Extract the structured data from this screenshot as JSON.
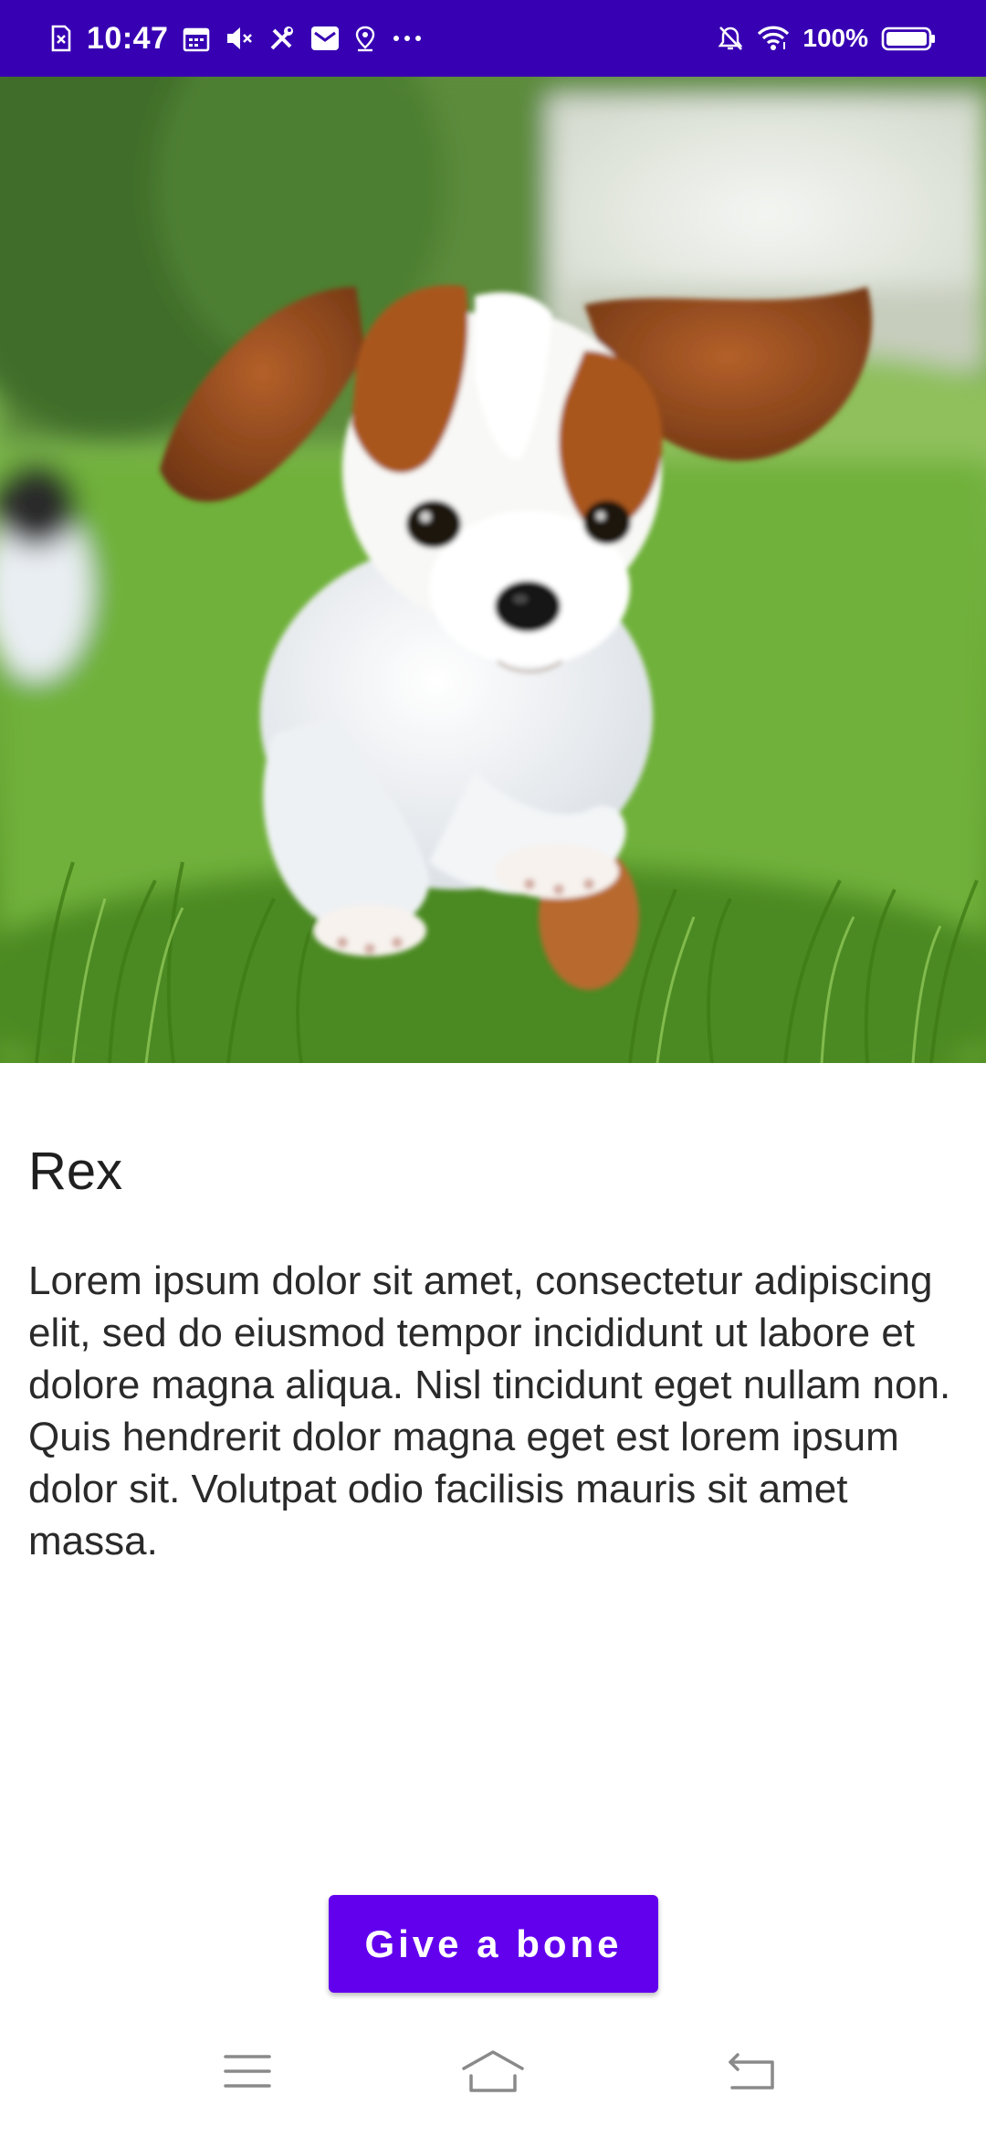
{
  "status_bar": {
    "time": "10:47",
    "battery_percent": "100%",
    "icons": [
      "sim-card-icon",
      "calendar-icon",
      "mute-icon",
      "tools-icon",
      "mail-icon",
      "location-icon",
      "more-dots-icon",
      "notifications-off-icon",
      "wifi-icon",
      "battery-icon"
    ],
    "background_color": "#3700B3"
  },
  "hero": {
    "image": "puppy-photo",
    "subject": "dog-photo"
  },
  "dog": {
    "name": "Rex",
    "description": "Lorem ipsum dolor sit amet, consectetur adipiscing elit, sed do eiusmod tempor incididunt ut labore et dolore magna aliqua. Nisl tincidunt eget nullam non. Quis hendrerit dolor magna eget est lorem ipsum dolor sit. Volutpat odio facilisis mauris sit amet massa."
  },
  "actions": {
    "give_bone_label": "Give a bone",
    "button_color": "#6200EE"
  },
  "nav_bar": {
    "icons": [
      "menu-icon",
      "home-icon",
      "back-icon"
    ]
  }
}
